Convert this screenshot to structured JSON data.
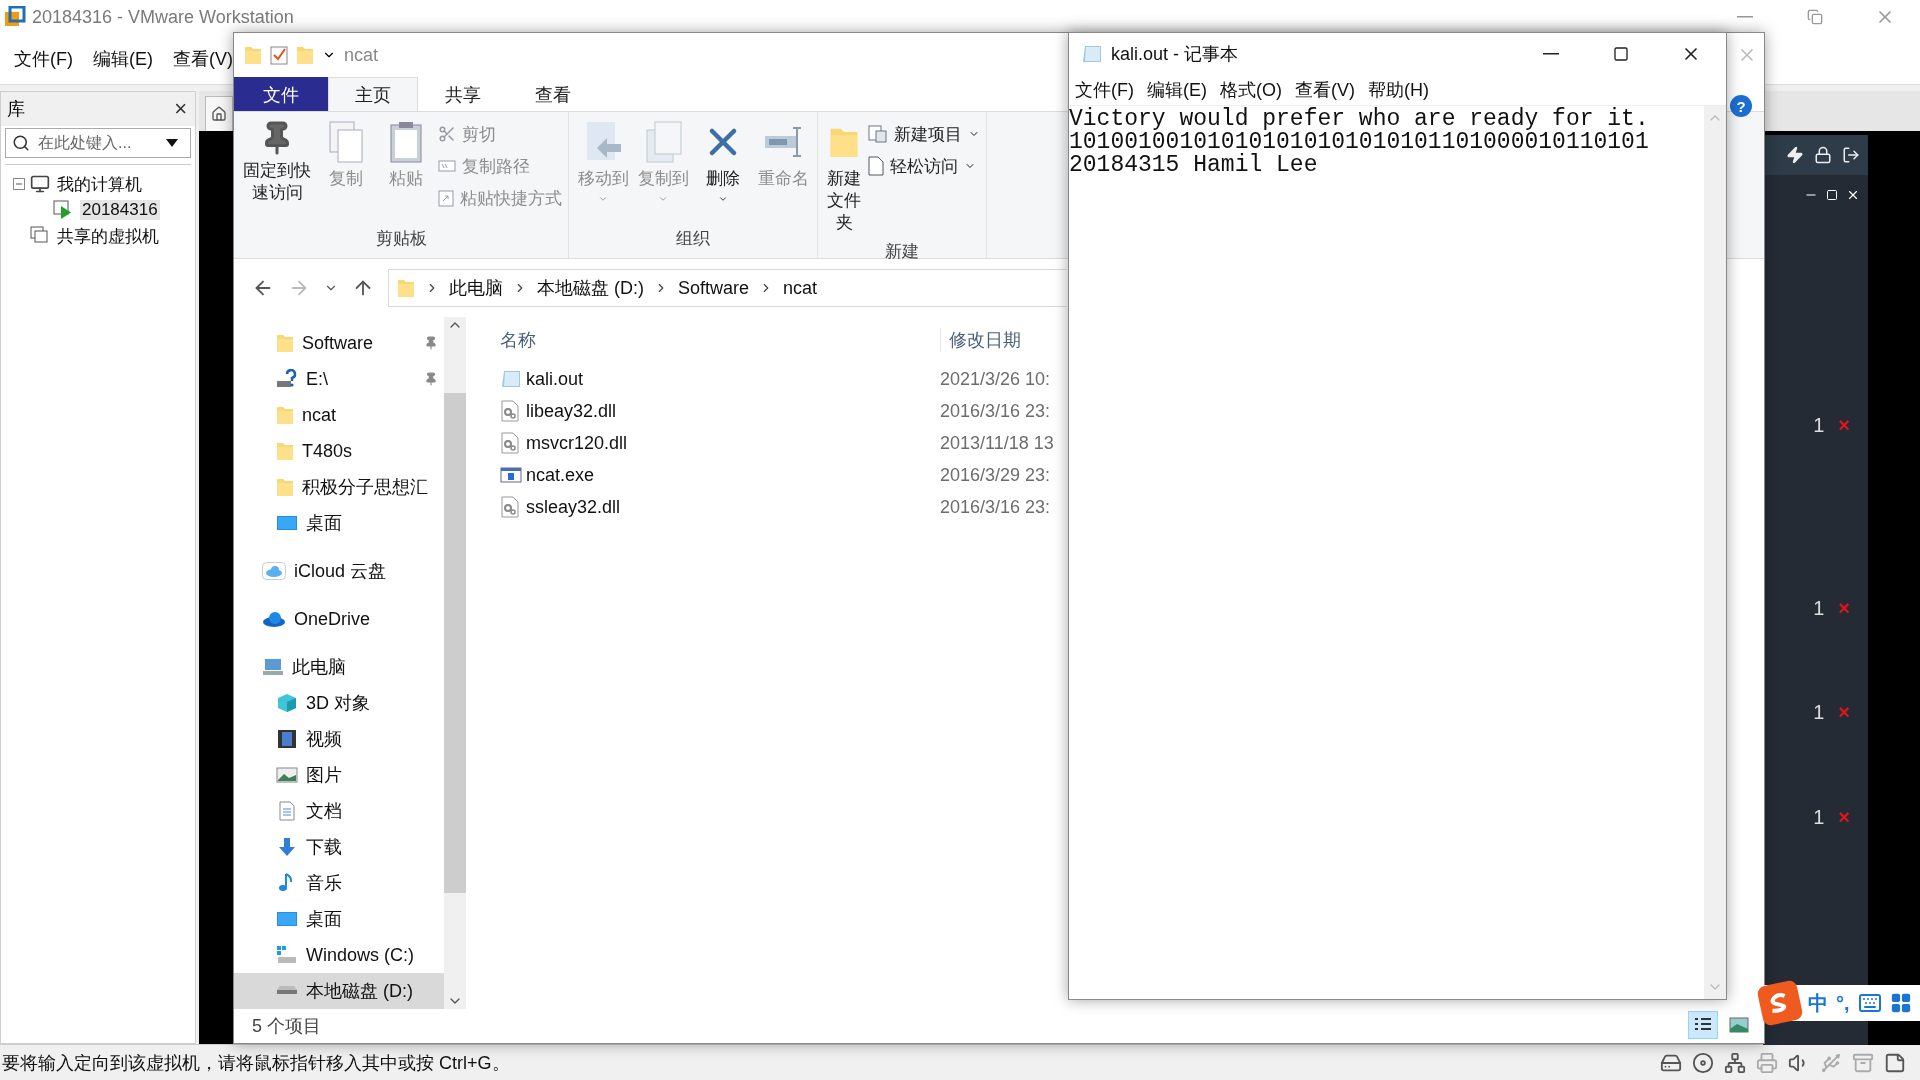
{
  "vmware": {
    "title": "20184316 - VMware Workstation",
    "menu": [
      "文件(F)",
      "编辑(E)",
      "查看(V)"
    ],
    "library": {
      "title": "库",
      "close": "×",
      "search": {
        "placeholder": "在此处键入..."
      },
      "tree": [
        {
          "label": "我的计算机",
          "kind": "pc",
          "expanded": true,
          "selected": false,
          "children": [
            {
              "label": "20184316",
              "kind": "vm",
              "selected": true
            }
          ]
        },
        {
          "label": "共享的虚拟机",
          "kind": "shared",
          "selected": false
        }
      ]
    },
    "status_bar": "要将输入定向到该虚拟机，请将鼠标指针移入其中或按 Ctrl+G。"
  },
  "explorer": {
    "title": "ncat",
    "ribbon_tabs": [
      {
        "label": "文件",
        "kind": "file",
        "selected": false
      },
      {
        "label": "主页",
        "kind": "tab",
        "selected": true
      },
      {
        "label": "共享",
        "kind": "tab",
        "selected": false
      },
      {
        "label": "查看",
        "kind": "tab",
        "selected": false
      }
    ],
    "ribbon_groups": [
      {
        "label": "剪贴板",
        "items": [
          {
            "label": "固定到快速访问",
            "kind": "pin",
            "disabled": false
          },
          {
            "label": "复制",
            "kind": "copy",
            "disabled": true
          },
          {
            "label": "粘贴",
            "kind": "paste",
            "disabled": true
          },
          {
            "label": "剪切",
            "kind": "cut",
            "disabled": true
          },
          {
            "label": "复制路径",
            "kind": "path",
            "disabled": true
          },
          {
            "label": "粘贴快捷方式",
            "kind": "shortcut",
            "disabled": true
          }
        ]
      },
      {
        "label": "组织",
        "items": [
          {
            "label": "移动到",
            "kind": "move",
            "disabled": true
          },
          {
            "label": "复制到",
            "kind": "copyto",
            "disabled": true
          },
          {
            "label": "删除",
            "kind": "delete",
            "disabled": false
          },
          {
            "label": "重命名",
            "kind": "rename",
            "disabled": true
          }
        ]
      },
      {
        "label": "新建",
        "items": [
          {
            "label": "新建文件夹",
            "kind": "folder",
            "disabled": false
          },
          {
            "label": "新建项目",
            "kind": "newitem",
            "disabled": false
          },
          {
            "label": "轻松访问",
            "kind": "easy",
            "disabled": false
          }
        ]
      }
    ],
    "help": "?",
    "breadcrumb": [
      "此电脑",
      "本地磁盘 (D:)",
      "Software",
      "ncat"
    ],
    "nav_pane": {
      "quick_access": [
        {
          "label": "Software",
          "kind": "folder",
          "pinned": true,
          "selected": false
        },
        {
          "label": "E:\\",
          "kind": "drive-unknown",
          "pinned": true,
          "selected": false
        },
        {
          "label": "ncat",
          "kind": "folder",
          "pinned": false,
          "selected": false
        },
        {
          "label": "T480s",
          "kind": "folder",
          "pinned": false,
          "selected": false
        },
        {
          "label": "积极分子思想汇",
          "kind": "folder",
          "pinned": false,
          "selected": false
        },
        {
          "label": "桌面",
          "kind": "desktop",
          "pinned": false,
          "selected": false
        }
      ],
      "locations": [
        {
          "label": "iCloud 云盘",
          "kind": "icloud",
          "selected": false
        },
        {
          "label": "OneDrive",
          "kind": "onedrive",
          "selected": false
        },
        {
          "label": "此电脑",
          "kind": "pc",
          "selected": false,
          "children": [
            {
              "label": "3D 对象",
              "kind": "cube",
              "selected": false
            },
            {
              "label": "视频",
              "kind": "video",
              "selected": false
            },
            {
              "label": "图片",
              "kind": "picture",
              "selected": false
            },
            {
              "label": "文档",
              "kind": "document",
              "selected": false
            },
            {
              "label": "下载",
              "kind": "download",
              "selected": false
            },
            {
              "label": "音乐",
              "kind": "music",
              "selected": false
            },
            {
              "label": "桌面",
              "kind": "desktop",
              "selected": false
            },
            {
              "label": "Windows (C:)",
              "kind": "windows-drive",
              "selected": false
            },
            {
              "label": "本地磁盘 (D:)",
              "kind": "drive",
              "selected": true
            }
          ]
        }
      ]
    },
    "columns": [
      "名称",
      "修改日期"
    ],
    "files": [
      {
        "name": "kali.out",
        "kind": "text",
        "modified": "2021/3/26 10:"
      },
      {
        "name": "libeay32.dll",
        "kind": "dll",
        "modified": "2016/3/16 23:"
      },
      {
        "name": "msvcr120.dll",
        "kind": "dll",
        "modified": "2013/11/18 13"
      },
      {
        "name": "ncat.exe",
        "kind": "exe",
        "modified": "2016/3/29 23:"
      },
      {
        "name": "ssleay32.dll",
        "kind": "dll",
        "modified": "2016/3/16 23:"
      }
    ],
    "status": "5 个项目",
    "views": [
      {
        "kind": "details",
        "selected": true
      },
      {
        "kind": "large-icons",
        "selected": false
      }
    ]
  },
  "notepad": {
    "title": "kali.out - 记事本",
    "menu": [
      "文件(F)",
      "编辑(E)",
      "格式(O)",
      "查看(V)",
      "帮助(H)"
    ],
    "lines": [
      "Victory would prefer who are ready for it.",
      "101001001010101010101010101101000010110101",
      "20184315 Hamil Lee"
    ]
  },
  "console": {
    "marks": [
      {
        "count": "1",
        "symbol": "×"
      },
      {
        "count": "1",
        "symbol": "×"
      },
      {
        "count": "1",
        "symbol": "×"
      },
      {
        "count": "1",
        "symbol": "×"
      }
    ]
  },
  "ime": {
    "mode": "中",
    "punctuation": "°,"
  }
}
